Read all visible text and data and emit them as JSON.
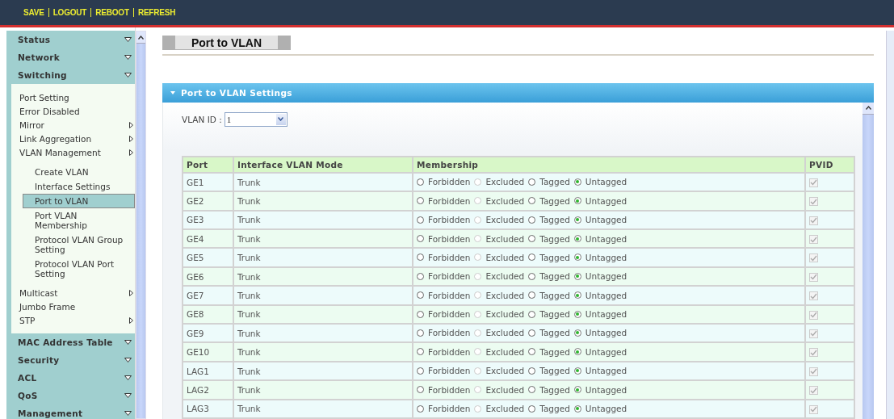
{
  "top_bar": {
    "links": [
      "SAVE",
      "LOGOUT",
      "REBOOT",
      "REFRESH"
    ]
  },
  "sidebar": {
    "sections": [
      {
        "label": "Status"
      },
      {
        "label": "Network"
      },
      {
        "label": "Switching",
        "items": [
          {
            "label": "Port Setting",
            "submenu": false
          },
          {
            "label": "Error Disabled",
            "submenu": false
          },
          {
            "label": "Mirror",
            "submenu": true
          },
          {
            "label": "Link Aggregation",
            "submenu": true
          },
          {
            "label": "VLAN Management",
            "submenu": true,
            "children": [
              {
                "label": "Create VLAN",
                "selected": false
              },
              {
                "label": "Interface Settings",
                "selected": false
              },
              {
                "label": "Port to VLAN",
                "selected": true
              },
              {
                "label": "Port VLAN Membership",
                "selected": false
              },
              {
                "label": "Protocol VLAN Group Setting",
                "selected": false
              },
              {
                "label": "Protocol VLAN Port Setting",
                "selected": false
              }
            ]
          },
          {
            "label": "Multicast",
            "submenu": true
          },
          {
            "label": "Jumbo Frame",
            "submenu": false
          },
          {
            "label": "STP",
            "submenu": true
          }
        ]
      },
      {
        "label": "MAC Address Table"
      },
      {
        "label": "Security"
      },
      {
        "label": "ACL"
      },
      {
        "label": "QoS"
      },
      {
        "label": "Management"
      }
    ]
  },
  "page": {
    "title": "Port to VLAN"
  },
  "panel": {
    "title": "Port to VLAN Settings",
    "vlan_id": {
      "label": "VLAN ID :",
      "value": "1"
    }
  },
  "table": {
    "columns": [
      "Port",
      "Interface VLAN Mode",
      "Membership",
      "PVID"
    ],
    "rows": [
      {
        "port": "GE1",
        "mode": "Trunk",
        "membership": [
          {
            "label": "Forbidden",
            "selected": false,
            "disabled": false
          },
          {
            "label": "Excluded",
            "selected": false,
            "disabled": true
          },
          {
            "label": "Tagged",
            "selected": false,
            "disabled": false
          },
          {
            "label": "Untagged",
            "selected": true,
            "disabled": false
          }
        ],
        "pvid": {
          "checked": true,
          "disabled": true
        }
      },
      {
        "port": "GE2",
        "mode": "Trunk",
        "membership": [
          {
            "label": "Forbidden",
            "selected": false,
            "disabled": false
          },
          {
            "label": "Excluded",
            "selected": false,
            "disabled": true
          },
          {
            "label": "Tagged",
            "selected": false,
            "disabled": false
          },
          {
            "label": "Untagged",
            "selected": true,
            "disabled": false
          }
        ],
        "pvid": {
          "checked": true,
          "disabled": true
        }
      },
      {
        "port": "GE3",
        "mode": "Trunk",
        "membership": [
          {
            "label": "Forbidden",
            "selected": false,
            "disabled": false
          },
          {
            "label": "Excluded",
            "selected": false,
            "disabled": true
          },
          {
            "label": "Tagged",
            "selected": false,
            "disabled": false
          },
          {
            "label": "Untagged",
            "selected": true,
            "disabled": false
          }
        ],
        "pvid": {
          "checked": true,
          "disabled": true
        }
      },
      {
        "port": "GE4",
        "mode": "Trunk",
        "membership": [
          {
            "label": "Forbidden",
            "selected": false,
            "disabled": false
          },
          {
            "label": "Excluded",
            "selected": false,
            "disabled": true
          },
          {
            "label": "Tagged",
            "selected": false,
            "disabled": false
          },
          {
            "label": "Untagged",
            "selected": true,
            "disabled": false
          }
        ],
        "pvid": {
          "checked": true,
          "disabled": true
        }
      },
      {
        "port": "GE5",
        "mode": "Trunk",
        "membership": [
          {
            "label": "Forbidden",
            "selected": false,
            "disabled": false
          },
          {
            "label": "Excluded",
            "selected": false,
            "disabled": true
          },
          {
            "label": "Tagged",
            "selected": false,
            "disabled": false
          },
          {
            "label": "Untagged",
            "selected": true,
            "disabled": false
          }
        ],
        "pvid": {
          "checked": true,
          "disabled": true
        }
      },
      {
        "port": "GE6",
        "mode": "Trunk",
        "membership": [
          {
            "label": "Forbidden",
            "selected": false,
            "disabled": false
          },
          {
            "label": "Excluded",
            "selected": false,
            "disabled": true
          },
          {
            "label": "Tagged",
            "selected": false,
            "disabled": false
          },
          {
            "label": "Untagged",
            "selected": true,
            "disabled": false
          }
        ],
        "pvid": {
          "checked": true,
          "disabled": true
        }
      },
      {
        "port": "GE7",
        "mode": "Trunk",
        "membership": [
          {
            "label": "Forbidden",
            "selected": false,
            "disabled": false
          },
          {
            "label": "Excluded",
            "selected": false,
            "disabled": true
          },
          {
            "label": "Tagged",
            "selected": false,
            "disabled": false
          },
          {
            "label": "Untagged",
            "selected": true,
            "disabled": false
          }
        ],
        "pvid": {
          "checked": true,
          "disabled": true
        }
      },
      {
        "port": "GE8",
        "mode": "Trunk",
        "membership": [
          {
            "label": "Forbidden",
            "selected": false,
            "disabled": false
          },
          {
            "label": "Excluded",
            "selected": false,
            "disabled": true
          },
          {
            "label": "Tagged",
            "selected": false,
            "disabled": false
          },
          {
            "label": "Untagged",
            "selected": true,
            "disabled": false
          }
        ],
        "pvid": {
          "checked": true,
          "disabled": true
        }
      },
      {
        "port": "GE9",
        "mode": "Trunk",
        "membership": [
          {
            "label": "Forbidden",
            "selected": false,
            "disabled": false
          },
          {
            "label": "Excluded",
            "selected": false,
            "disabled": true
          },
          {
            "label": "Tagged",
            "selected": false,
            "disabled": false
          },
          {
            "label": "Untagged",
            "selected": true,
            "disabled": false
          }
        ],
        "pvid": {
          "checked": true,
          "disabled": true
        }
      },
      {
        "port": "GE10",
        "mode": "Trunk",
        "membership": [
          {
            "label": "Forbidden",
            "selected": false,
            "disabled": false
          },
          {
            "label": "Excluded",
            "selected": false,
            "disabled": true
          },
          {
            "label": "Tagged",
            "selected": false,
            "disabled": false
          },
          {
            "label": "Untagged",
            "selected": true,
            "disabled": false
          }
        ],
        "pvid": {
          "checked": true,
          "disabled": true
        }
      },
      {
        "port": "LAG1",
        "mode": "Trunk",
        "membership": [
          {
            "label": "Forbidden",
            "selected": false,
            "disabled": false
          },
          {
            "label": "Excluded",
            "selected": false,
            "disabled": true
          },
          {
            "label": "Tagged",
            "selected": false,
            "disabled": false
          },
          {
            "label": "Untagged",
            "selected": true,
            "disabled": false
          }
        ],
        "pvid": {
          "checked": true,
          "disabled": true
        }
      },
      {
        "port": "LAG2",
        "mode": "Trunk",
        "membership": [
          {
            "label": "Forbidden",
            "selected": false,
            "disabled": false
          },
          {
            "label": "Excluded",
            "selected": false,
            "disabled": true
          },
          {
            "label": "Tagged",
            "selected": false,
            "disabled": false
          },
          {
            "label": "Untagged",
            "selected": true,
            "disabled": false
          }
        ],
        "pvid": {
          "checked": true,
          "disabled": true
        }
      },
      {
        "port": "LAG3",
        "mode": "Trunk",
        "membership": [
          {
            "label": "Forbidden",
            "selected": false,
            "disabled": false
          },
          {
            "label": "Excluded",
            "selected": false,
            "disabled": true
          },
          {
            "label": "Tagged",
            "selected": false,
            "disabled": false
          },
          {
            "label": "Untagged",
            "selected": true,
            "disabled": false
          }
        ],
        "pvid": {
          "checked": true,
          "disabled": true
        }
      }
    ]
  }
}
